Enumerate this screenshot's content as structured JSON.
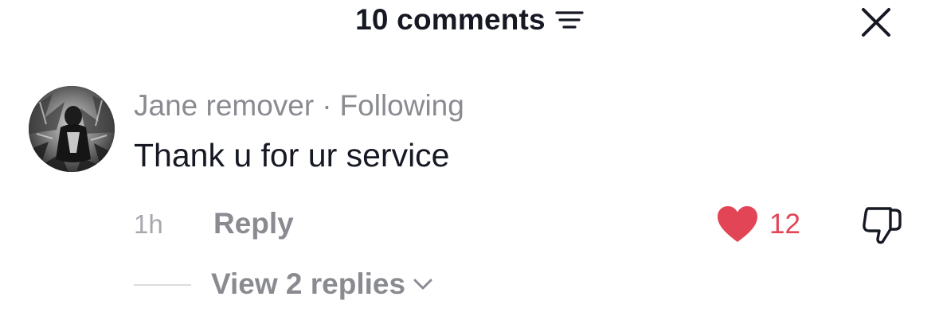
{
  "header": {
    "title": "10 comments",
    "filter_icon": "filter-icon",
    "close_icon": "close-icon"
  },
  "comment": {
    "author": "Jane remover",
    "separator": "·",
    "relationship": "Following",
    "text": "Thank u for ur service",
    "time": "1h",
    "reply_label": "Reply",
    "likes": "12",
    "view_replies_label": "View 2 replies"
  },
  "colors": {
    "like": "#e24556",
    "text_primary": "#161823",
    "text_secondary": "#8a8b91"
  }
}
